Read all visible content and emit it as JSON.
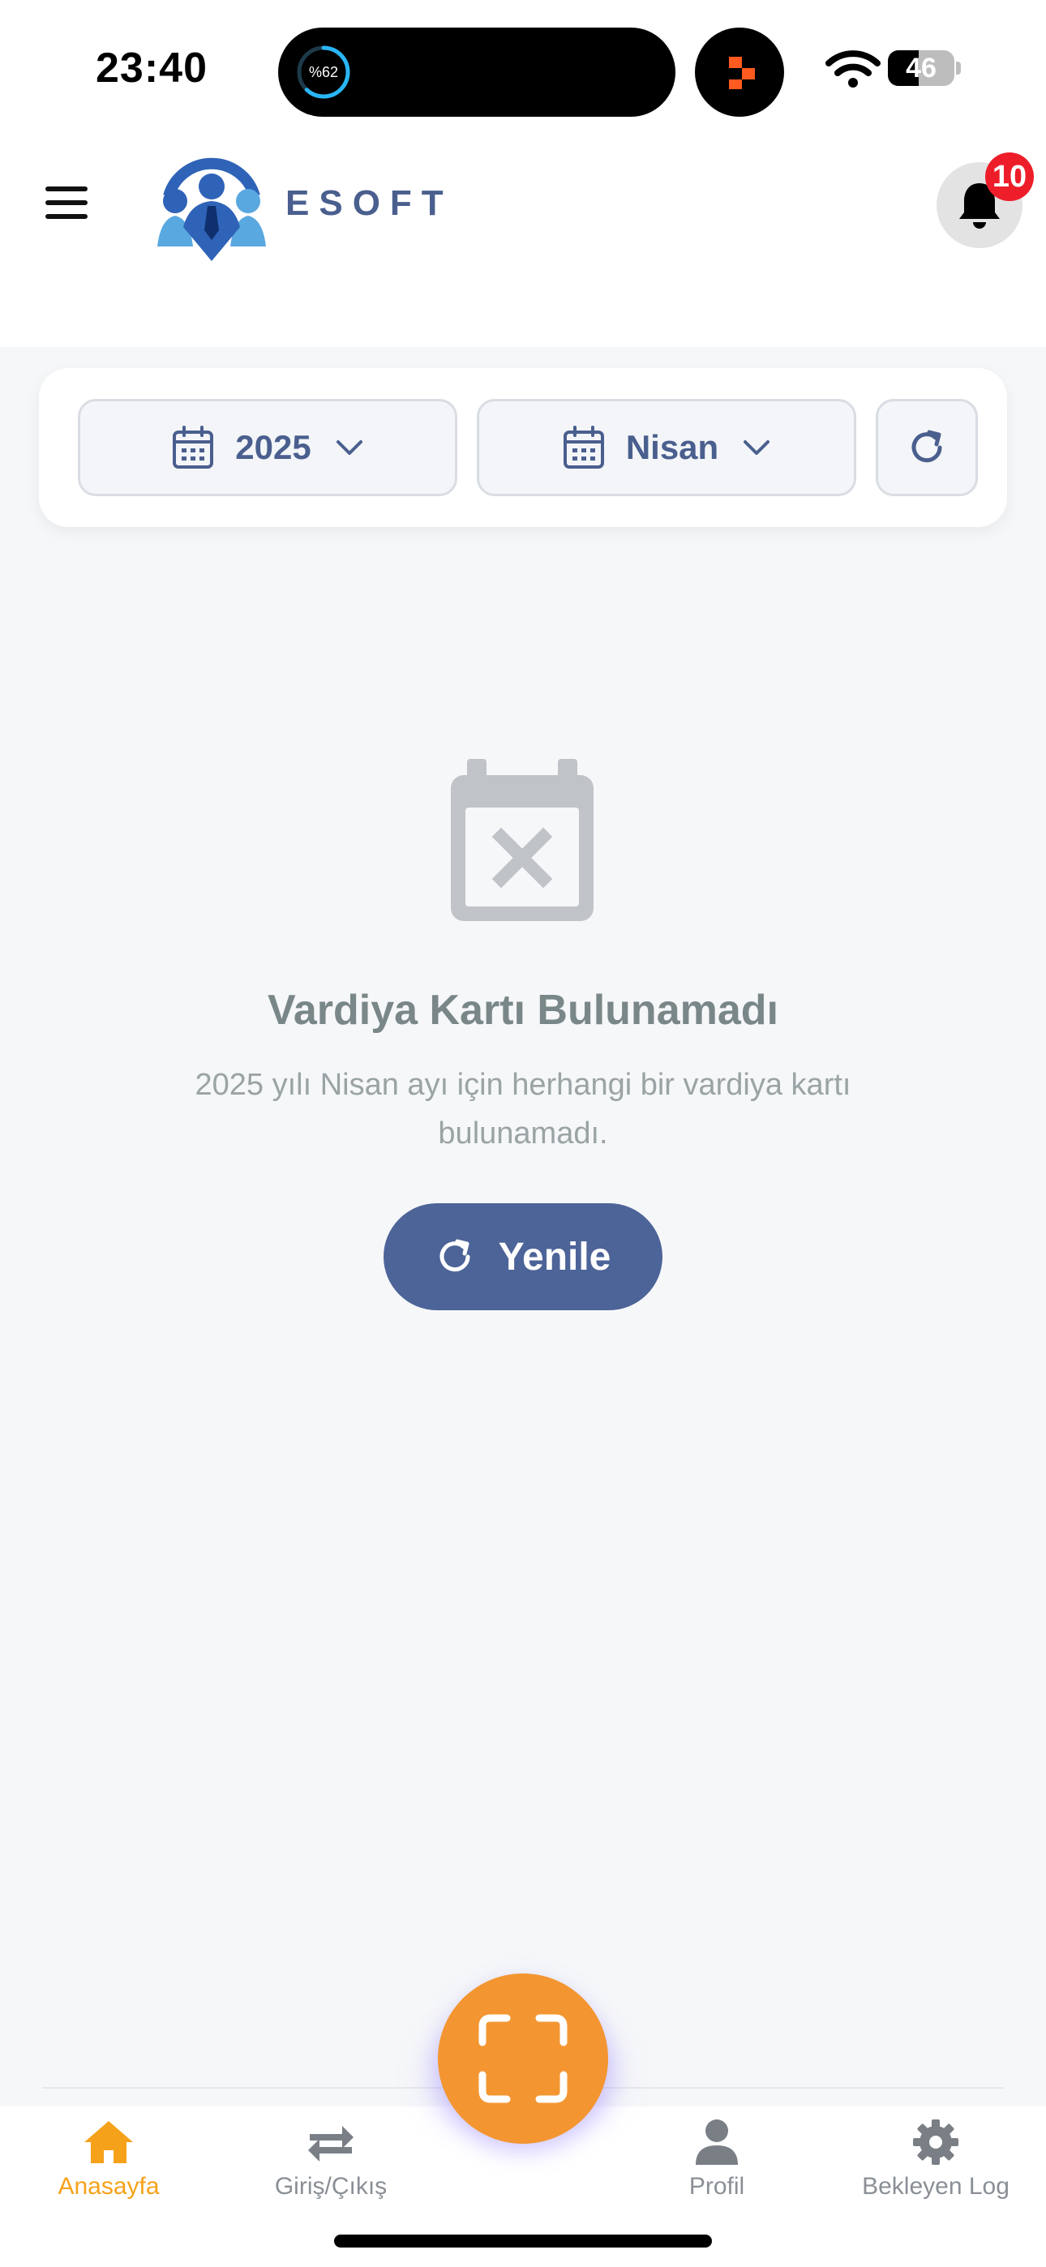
{
  "status_bar": {
    "time": "23:40",
    "ring_label": "%62",
    "ring_fraction": 0.62,
    "battery_level": "46",
    "battery_fraction": 0.46
  },
  "header": {
    "brand": "ESOFT",
    "notification_count": "10"
  },
  "filters": {
    "year": "2025",
    "month": "Nisan"
  },
  "empty_state": {
    "title": "Vardiya Kartı Bulunamadı",
    "description": "2025 yılı Nisan ayı için herhangi bir vardiya kartı bulunamadı.",
    "button_label": "Yenile"
  },
  "bottom_nav": {
    "items": [
      {
        "label": "Anasayfa",
        "icon": "home-icon",
        "active": true
      },
      {
        "label": "Giriş/Çıkış",
        "icon": "swap-arrows-icon",
        "active": false
      },
      {
        "label": "Profil",
        "icon": "user-icon",
        "active": false
      },
      {
        "label": "Bekleyen Log",
        "icon": "gear-icon",
        "active": false
      }
    ],
    "center_action_icon": "scan-icon"
  },
  "colors": {
    "primary": "#4d6498",
    "brand_text": "#4a5f8e",
    "accent_orange": "#f39632",
    "active_nav": "#f5a21a",
    "badge_red": "#ee1d2a",
    "empty_icon": "#c0c4c9"
  }
}
